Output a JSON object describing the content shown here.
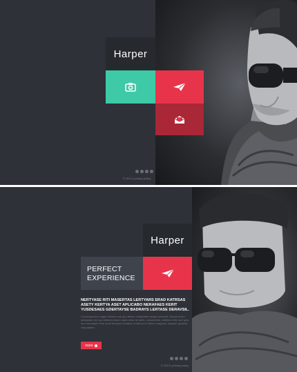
{
  "brand": {
    "name": "Harper"
  },
  "top_panel": {
    "footer": "© 2013 | privacy policy",
    "icons": [
      "camera-icon",
      "paper-plane-icon",
      "envelope-icon"
    ]
  },
  "bottom_panel": {
    "tagline_line1": "PERFECT",
    "tagline_line2": "EXPERIENCE",
    "headline": "NERTYASE RITI MASERTAS LERTYARS ERAD KATRSAS ASETY KERTYA ASET APLICABO NERAFAES KERIT YUSDESAES GDERTAYSE BADRAYS LERTASE DERAVSIL.",
    "body": "Consequuntur magni dolores eos qui ratione voluptatem sequi nesciunt. Neque porro quisquam est, qui dolorem ipsum quia dolor sit amet, consectetur, adipisci velit, sed quia non numquam eius modi tempora incidunt ut labore et dolore magnam aliquam quaerat voluptatem.",
    "more_label": "more",
    "footer": "© 2013 | privacy policy"
  },
  "colors": {
    "background": "#2e3137",
    "accent_red": "#e8344a",
    "accent_teal": "#3ec9a7",
    "dark_red": "#a92737"
  }
}
